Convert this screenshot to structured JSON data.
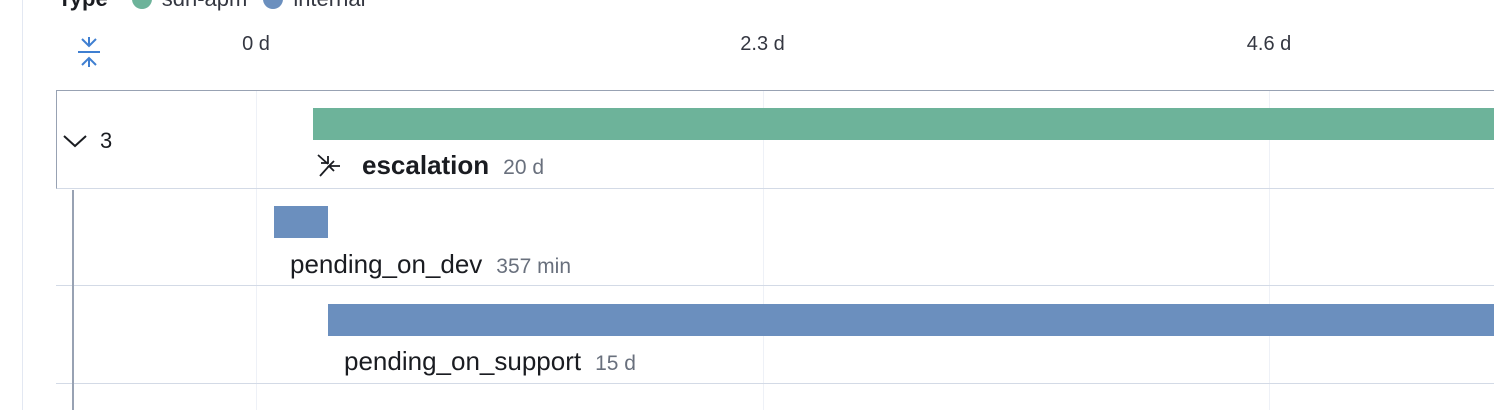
{
  "legend": {
    "title": "Type",
    "items": [
      {
        "label": "sdh-apm",
        "color": "#6db39a"
      },
      {
        "label": "internal",
        "color": "#6b8fbe"
      }
    ]
  },
  "axis": {
    "ticks": [
      {
        "label": "0 d",
        "days": 0
      },
      {
        "label": "2.3 d",
        "days": 2.3
      },
      {
        "label": "4.6 d",
        "days": 4.6
      }
    ]
  },
  "group": {
    "count": "3"
  },
  "spans": [
    {
      "name": "escalation",
      "duration": "20 d",
      "type": "sdh-apm",
      "color": "#6db39a",
      "start_days": 0.26,
      "duration_days": 20,
      "incoming_icon": "incoming-arrows-icon"
    },
    {
      "name": "pending_on_dev",
      "duration": "357 min",
      "type": "internal",
      "color": "#6b8fbe",
      "start_days": 0.08,
      "duration_days": 0.248
    },
    {
      "name": "pending_on_support",
      "duration": "15 d",
      "type": "internal",
      "color": "#6b8fbe",
      "start_days": 0.326,
      "duration_days": 15
    }
  ],
  "icons": {
    "collapse": "collapse-all-icon",
    "chevron": "chevron-down-icon"
  }
}
